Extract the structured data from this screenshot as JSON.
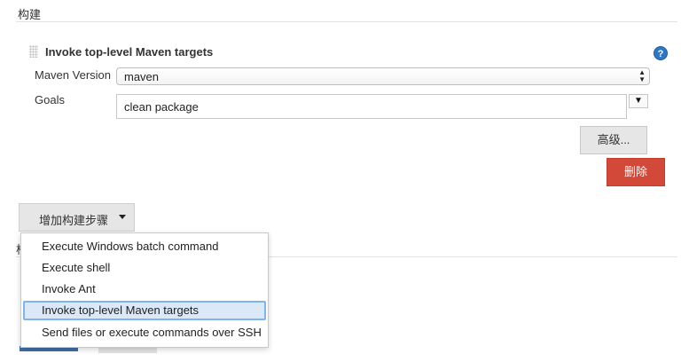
{
  "section": {
    "title": "构建"
  },
  "build_step": {
    "title": "Invoke top-level Maven targets",
    "help_icon": "?",
    "maven_version_label": "Maven Version",
    "maven_version_value": "maven",
    "goals_label": "Goals",
    "goals_value": "clean package",
    "advanced_label": "高级...",
    "delete_label": "删除"
  },
  "add_step": {
    "label": "增加构建步骤"
  },
  "next_section": {
    "title_fragment": "构"
  },
  "menu": {
    "items": [
      "Execute Windows batch command",
      "Execute shell",
      "Invoke Ant",
      "Invoke top-level Maven targets",
      "Send files or execute commands over SSH"
    ],
    "selected_index": 3
  },
  "colors": {
    "delete": "#d24939",
    "help": "#2f77c5",
    "selected_bg": "#dbe8f7",
    "selected_border": "#7fb3ea"
  }
}
